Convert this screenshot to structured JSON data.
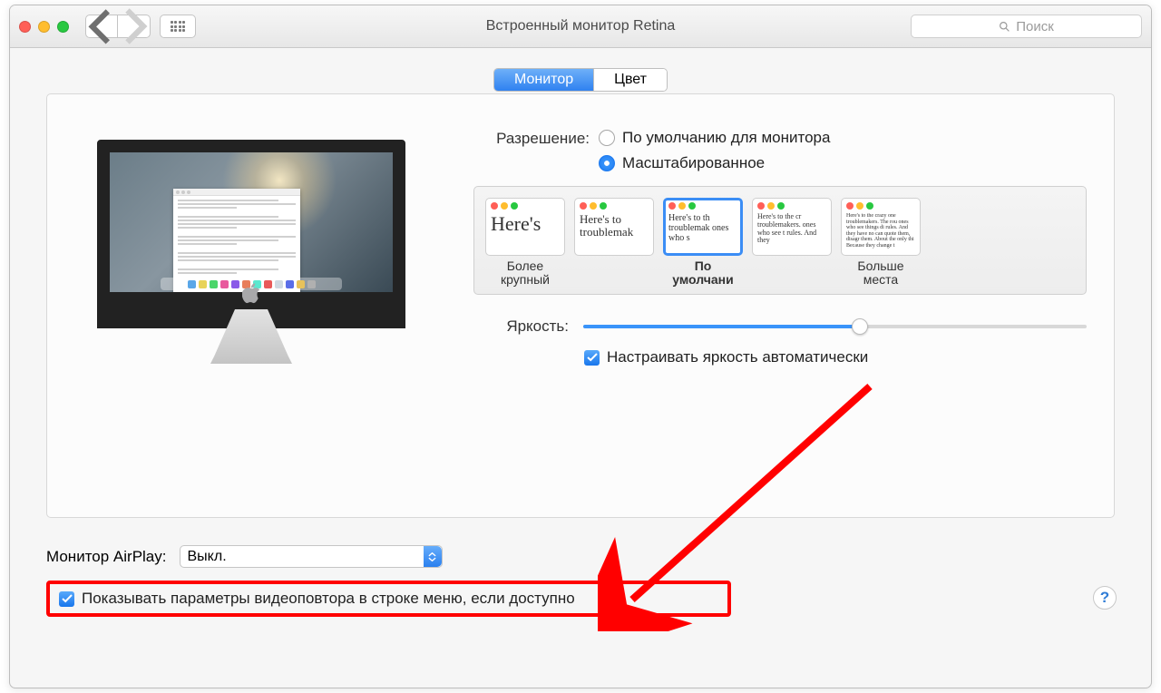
{
  "window": {
    "title": "Встроенный монитор Retina"
  },
  "search": {
    "placeholder": "Поиск"
  },
  "tabs": {
    "monitor": "Монитор",
    "color": "Цвет",
    "active": "monitor"
  },
  "resolution": {
    "label": "Разрешение:",
    "option_default": "По умолчанию для монитора",
    "option_scaled": "Масштабированное",
    "selected": "scaled"
  },
  "scale_options": [
    {
      "label": "Более\nкрупный",
      "preview": "Here's",
      "font": 22,
      "selected": false
    },
    {
      "label": " ",
      "preview": "Here's to troublemak",
      "font": 13,
      "selected": false
    },
    {
      "label": "По\nумолчани",
      "preview": "Here's to th troublemak ones who s",
      "font": 10,
      "selected": true
    },
    {
      "label": " ",
      "preview": "Here's to the cr troublemakers. ones who see t rules. And they",
      "font": 8,
      "selected": false
    },
    {
      "label": "Больше\nместа",
      "preview": "Here's to the crazy one troublemakers. The rou ones who see things di rules. And they have no can quote them, disagr them. About the only thi Because they change t",
      "font": 6,
      "selected": false
    }
  ],
  "brightness": {
    "label": "Яркость:",
    "value_pct": 55
  },
  "auto_brightness": {
    "label": "Настраивать яркость автоматически",
    "checked": true
  },
  "airplay": {
    "label": "Монитор AirPlay:",
    "value": "Выкл."
  },
  "mirror_checkbox": {
    "label": "Показывать параметры видеоповтора в строке меню, если доступно",
    "checked": true
  },
  "help_button": "?",
  "colors": {
    "accent": "#2f81f0",
    "highlight": "#ff0000"
  }
}
